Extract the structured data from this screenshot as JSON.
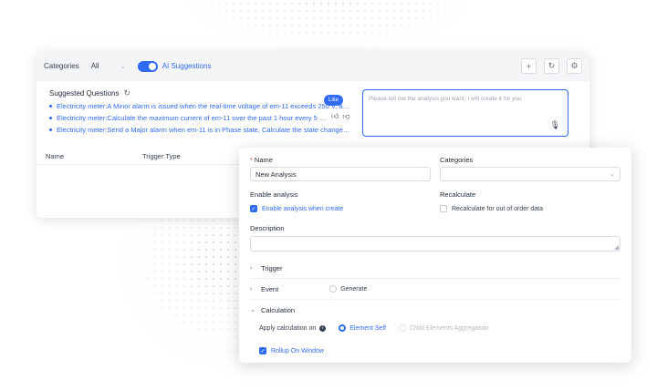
{
  "toolbar": {
    "categories_label": "Categories",
    "categories_value": "All",
    "ai_suggestions_label": "AI Suggestions"
  },
  "suggested": {
    "title": "Suggested Questions",
    "questions": [
      "Electricity meter:A Minor alarm is issued when the real-time voltage of em-11 exceeds 250 V, and...",
      "Electricity meter:Calculate the maximum current of em-11 over the past 1 hour every 5 min...",
      "Electricity meter:Send a Major alarm when em-11 is in Phase state, Calculate the state change time"
    ],
    "like_tooltip": "Like"
  },
  "ai_input": {
    "placeholder": "Please tell me the analysis you want, I will create it for you"
  },
  "table": {
    "headers": [
      "Name",
      "Trigger Type"
    ]
  },
  "form": {
    "name_label": "Name",
    "name_value": "New Analysis",
    "categories_label": "Categories",
    "categories_value": "",
    "enable_label": "Enable analysis",
    "enable_checkbox": "Enable analysis when create",
    "recalculate_label": "Recalculate",
    "recalculate_checkbox": "Recalculate for out of order data",
    "description_label": "Description",
    "description_value": "",
    "trigger_label": "Trigger",
    "event_label": "Event",
    "generate_label": "Generate",
    "calculation_label": "Calculation",
    "apply_calc_label": "Apply calculation on",
    "element_self_label": "Element Self",
    "child_agg_label": "Child Elements Aggregation",
    "rollup_label": "Rollup On Window"
  },
  "colors": {
    "accent": "#2f6bf3",
    "required": "#e53e3e"
  }
}
